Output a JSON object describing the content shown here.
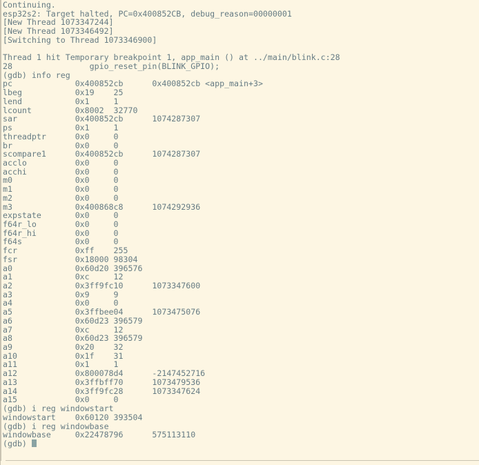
{
  "terminal": {
    "background_color": "#FDF6E3",
    "foreground_color": "#657B83",
    "cursor_color": "#8aa3a3",
    "border_color": "#c9c3b2",
    "prompt": "(gdb) ",
    "columns": 92,
    "rows": 53
  },
  "session": {
    "program": "gdb",
    "target": "esp32s2",
    "lines": [
      "Continuing.",
      "esp32s2: Target halted, PC=0x400852CB, debug_reason=00000001",
      "[New Thread 1073347244]",
      "[New Thread 1073346492]",
      "[Switching to Thread 1073346900]",
      "",
      "Thread 1 hit Temporary breakpoint 1, app_main () at ../main/blink.c:28",
      "28\t        gpio_reset_pin(BLINK_GPIO);",
      "(gdb) info reg"
    ],
    "commands": {
      "info_reg": "info reg",
      "i_reg_windowstart": "i reg windowstart",
      "i_reg_windowbase": "i reg windowbase"
    },
    "breakpoint": {
      "thread": "Thread 1",
      "kind": "Temporary breakpoint 1",
      "function": "app_main ()",
      "file": "../main/blink.c",
      "line_number": "28",
      "source_line": "gpio_reset_pin(BLINK_GPIO);"
    },
    "halt": {
      "chip": "esp32s2",
      "message": "Target halted",
      "pc": "0x400852CB",
      "debug_reason": "00000001"
    },
    "threads": [
      "[New Thread 1073347244]",
      "[New Thread 1073346492]",
      "[Switching to Thread 1073346900]"
    ]
  },
  "registers": {
    "columns": [
      "name",
      "hex",
      "natural"
    ],
    "rows": [
      {
        "name": "pc",
        "hex": "0x400852cb",
        "natural": "0x400852cb <app_main+3>"
      },
      {
        "name": "lbeg",
        "hex": "0x19",
        "natural": "25"
      },
      {
        "name": "lend",
        "hex": "0x1",
        "natural": "1"
      },
      {
        "name": "lcount",
        "hex": "0x8002",
        "natural": "32770"
      },
      {
        "name": "sar",
        "hex": "0x400852cb",
        "natural": "1074287307"
      },
      {
        "name": "ps",
        "hex": "0x1",
        "natural": "1"
      },
      {
        "name": "threadptr",
        "hex": "0x0",
        "natural": "0"
      },
      {
        "name": "br",
        "hex": "0x0",
        "natural": "0"
      },
      {
        "name": "scompare1",
        "hex": "0x400852cb",
        "natural": "1074287307"
      },
      {
        "name": "acclo",
        "hex": "0x0",
        "natural": "0"
      },
      {
        "name": "acchi",
        "hex": "0x0",
        "natural": "0"
      },
      {
        "name": "m0",
        "hex": "0x0",
        "natural": "0"
      },
      {
        "name": "m1",
        "hex": "0x0",
        "natural": "0"
      },
      {
        "name": "m2",
        "hex": "0x0",
        "natural": "0"
      },
      {
        "name": "m3",
        "hex": "0x400868c8",
        "natural": "1074292936"
      },
      {
        "name": "expstate",
        "hex": "0x0",
        "natural": "0"
      },
      {
        "name": "f64r_lo",
        "hex": "0x0",
        "natural": "0"
      },
      {
        "name": "f64r_hi",
        "hex": "0x0",
        "natural": "0"
      },
      {
        "name": "f64s",
        "hex": "0x0",
        "natural": "0"
      },
      {
        "name": "fcr",
        "hex": "0xff",
        "natural": "255"
      },
      {
        "name": "fsr",
        "hex": "0x18000",
        "natural": "98304"
      },
      {
        "name": "a0",
        "hex": "0x60d20",
        "natural": "396576"
      },
      {
        "name": "a1",
        "hex": "0xc",
        "natural": "12"
      },
      {
        "name": "a2",
        "hex": "0x3ff9fc10",
        "natural": "1073347600"
      },
      {
        "name": "a3",
        "hex": "0x9",
        "natural": "9"
      },
      {
        "name": "a4",
        "hex": "0x0",
        "natural": "0"
      },
      {
        "name": "a5",
        "hex": "0x3ffbee04",
        "natural": "1073475076"
      },
      {
        "name": "a6",
        "hex": "0x60d23",
        "natural": "396579"
      },
      {
        "name": "a7",
        "hex": "0xc",
        "natural": "12"
      },
      {
        "name": "a8",
        "hex": "0x60d23",
        "natural": "396579"
      },
      {
        "name": "a9",
        "hex": "0x20",
        "natural": "32"
      },
      {
        "name": "a10",
        "hex": "0x1f",
        "natural": "31"
      },
      {
        "name": "a11",
        "hex": "0x1",
        "natural": "1"
      },
      {
        "name": "a12",
        "hex": "0x800078d4",
        "natural": "-2147452716"
      },
      {
        "name": "a13",
        "hex": "0x3ffbff70",
        "natural": "1073479536"
      },
      {
        "name": "a14",
        "hex": "0x3ff9fc28",
        "natural": "1073347624"
      },
      {
        "name": "a15",
        "hex": "0x0",
        "natural": "0"
      }
    ],
    "windowstart": {
      "name": "windowstart",
      "hex": "0x60120",
      "natural": "393504"
    },
    "windowbase": {
      "name": "windowbase",
      "hex": "0x22478796",
      "natural": "575113110"
    }
  }
}
